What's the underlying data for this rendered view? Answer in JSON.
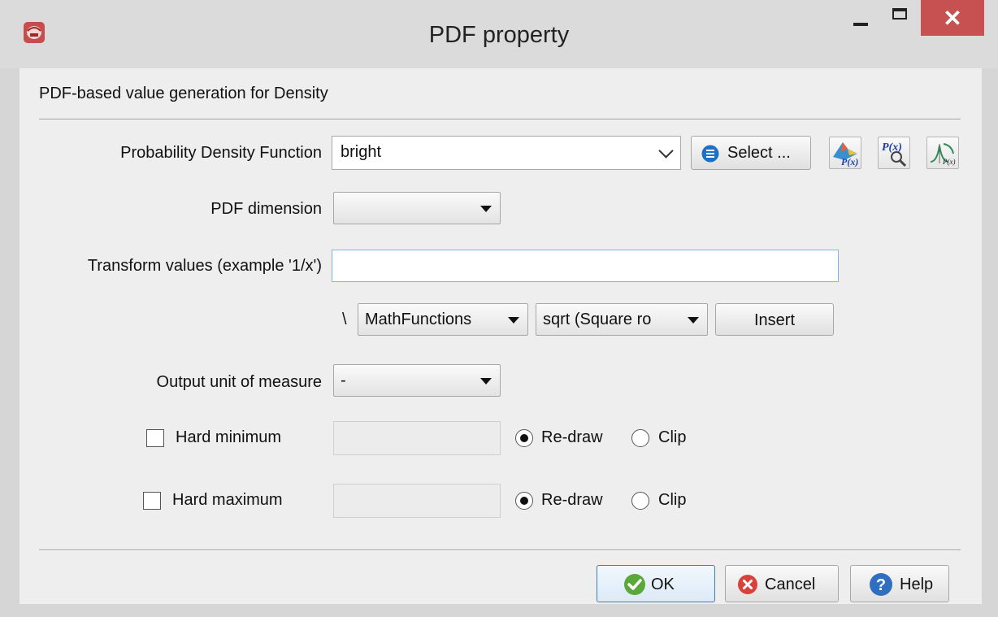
{
  "window": {
    "title": "PDF property",
    "close_glyph": "✕",
    "colors": {
      "close_button": "#c75050",
      "field_focus_border": "#7eb4ea",
      "accent_blue": "#1e6fc7"
    }
  },
  "header": {
    "text": "PDF-based value generation for Density"
  },
  "pdf_function": {
    "label": "Probability Density Function",
    "value": "bright",
    "select_button": "Select ...",
    "select_icon": "list-circle-icon",
    "tool_icons": [
      "pdf-surface-icon",
      "pdf-magnifier-icon",
      "pdf-distribution-icon"
    ]
  },
  "pdf_dimension": {
    "label": "PDF dimension",
    "value": ""
  },
  "transform": {
    "label": "Transform values (example '1/x')",
    "value": "",
    "prefix": "\\",
    "category": "MathFunctions",
    "function": "sqrt (Square ro",
    "insert_button": "Insert"
  },
  "output_unit": {
    "label": "Output unit of measure",
    "value": "-"
  },
  "hard_minimum": {
    "label": "Hard minimum",
    "checked": false,
    "value": "",
    "redraw_label": "Re-draw",
    "clip_label": "Clip",
    "selected": "Re-draw"
  },
  "hard_maximum": {
    "label": "Hard maximum",
    "checked": false,
    "value": "",
    "redraw_label": "Re-draw",
    "clip_label": "Clip",
    "selected": "Re-draw"
  },
  "footer": {
    "ok": "OK",
    "cancel": "Cancel",
    "help": "Help"
  }
}
